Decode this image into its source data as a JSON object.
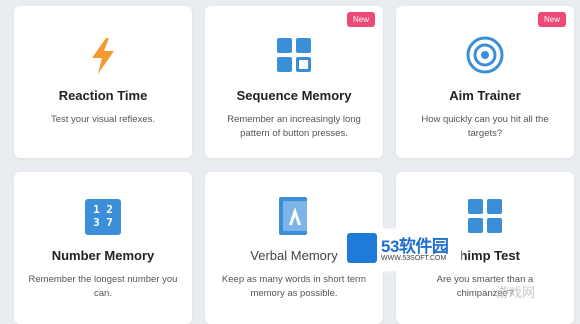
{
  "cards": [
    {
      "title": "Reaction Time",
      "desc": "Test your visual reflexes.",
      "icon": "lightning-icon"
    },
    {
      "title": "Sequence Memory",
      "desc": "Remember an increasingly long pattern of button presses.",
      "badge": "New",
      "icon": "grid-squares-icon"
    },
    {
      "title": "Aim Trainer",
      "desc": "How quickly can you hit all the targets?",
      "badge": "New",
      "icon": "target-icon"
    },
    {
      "title": "Number Memory",
      "desc": "Remember the longest number you can.",
      "icon": "number-grid-icon"
    },
    {
      "title": "Verbal Memory",
      "desc": "Keep as many words in short term memory as possible.",
      "icon": "book-icon"
    },
    {
      "title": "Chimp Test",
      "desc": "Are you smarter than a chimpanzee?",
      "icon": "grid-squares-icon"
    }
  ],
  "number_icon_digits": "1 2 3 7",
  "watermark": {
    "name": "53软件园",
    "url": "WWW.53SOFT.COM"
  },
  "corner_text": "游戏网",
  "colors": {
    "accent": "#3b8fd9",
    "badge": "#ea4a73",
    "lightning": "#f59a2f"
  }
}
